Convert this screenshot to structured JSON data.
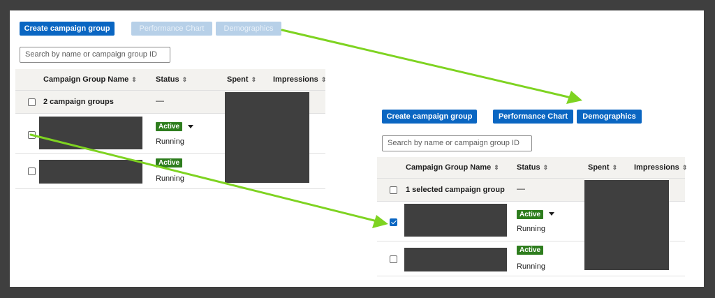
{
  "colors": {
    "frame": "#3f3f3f",
    "primary": "#0a66c2",
    "badge": "#2e7d1e",
    "arrow": "#7ed321"
  },
  "before": {
    "create_button": "Create campaign group",
    "performance_button": "Performance Chart",
    "demographics_button": "Demographics",
    "search_placeholder": "Search by name or campaign group ID",
    "columns": {
      "name": "Campaign Group Name",
      "status": "Status",
      "spent": "Spent",
      "impressions": "Impressions"
    },
    "sort_icon": "⇕",
    "summary_label": "2 campaign groups",
    "summary_status": "—",
    "rows": [
      {
        "badge": "Active",
        "state": "Running",
        "checked": false
      },
      {
        "badge": "Active",
        "state": "Running",
        "checked": false
      }
    ]
  },
  "after": {
    "create_button": "Create campaign group",
    "performance_button": "Performance Chart",
    "demographics_button": "Demographics",
    "search_placeholder": "Search by name or campaign group ID",
    "columns": {
      "name": "Campaign Group Name",
      "status": "Status",
      "spent": "Spent",
      "impressions": "Impressions"
    },
    "sort_icon": "⇕",
    "summary_label": "1 selected campaign group",
    "summary_status": "—",
    "rows": [
      {
        "badge": "Active",
        "state": "Running",
        "checked": true
      },
      {
        "badge": "Active",
        "state": "Running",
        "checked": false
      }
    ]
  }
}
